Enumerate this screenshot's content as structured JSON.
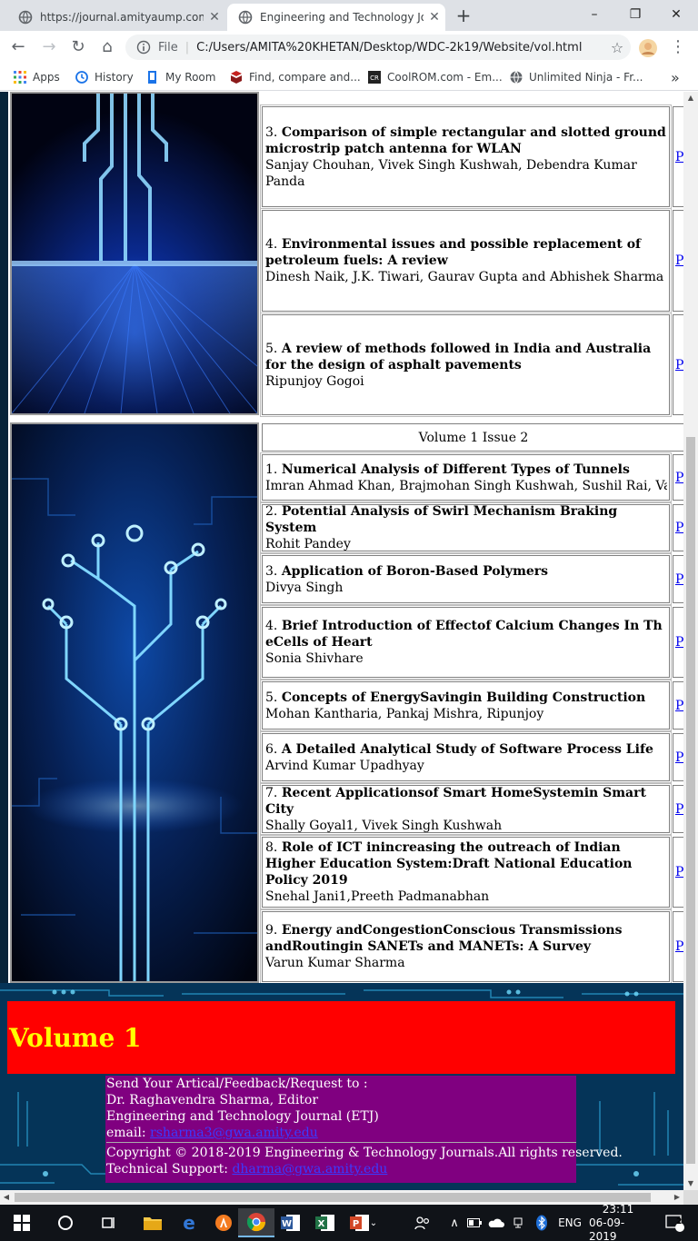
{
  "browser": {
    "tabs": [
      {
        "title": "https://journal.amityaump.com/p",
        "active": false
      },
      {
        "title": "Engineering and Technology Jour",
        "active": true
      }
    ],
    "new_tab": "+",
    "window_controls": {
      "minimize": "–",
      "maximize": "❐",
      "close": "✕"
    },
    "nav": {
      "back": "←",
      "forward": "→",
      "reload": "↻",
      "home": "⌂"
    },
    "address": {
      "scheme_label": "File",
      "separator": "|",
      "url": "C:/Users/AMITA%20KHETAN/Desktop/WDC-2k19/Website/vol.html"
    },
    "menu": "⋮",
    "bookmarks": [
      {
        "label": "Apps",
        "icon": "apps-grid-icon"
      },
      {
        "label": "History",
        "icon": "history-icon"
      },
      {
        "label": "My Room",
        "icon": "room-icon"
      },
      {
        "label": "Find, compare and...",
        "icon": "book-icon"
      },
      {
        "label": "CoolROM.com - Em...",
        "icon": "coolrom-icon"
      },
      {
        "label": "Unlimited Ninja - Fr...",
        "icon": "globe-icon"
      }
    ],
    "bookmarks_more": "»"
  },
  "issue1_tail": [
    {
      "num": "3.",
      "title": "Comparison of simple rectangular and slotted ground microstrip patch antenna for WLAN",
      "authors": "Sanjay Chouhan, Vivek Singh Kushwah, Debendra Kumar Panda",
      "link": "P"
    },
    {
      "num": "4.",
      "title": "Environmental issues and possible replacement of petroleum fuels: A review",
      "authors": "Dinesh Naik, J.K. Tiwari, Gaurav Gupta and Abhishek Sharma",
      "link": "P"
    },
    {
      "num": "5.",
      "title": "A review of methods followed in India and Australia for the design of asphalt pavements",
      "authors": "Ripunjoy Gogoi",
      "link": "P"
    }
  ],
  "issue2": {
    "header": "Volume 1 Issue 2",
    "articles": [
      {
        "num": "1.",
        "title": "Numerical Analysis of Different Types of Tunnels",
        "authors": "Imran Ahmad Khan, Brajmohan Singh Kushwah, Sushil Rai, Vaibhav",
        "link": "P"
      },
      {
        "num": "2.",
        "title": "Potential Analysis of Swirl Mechanism Braking System",
        "authors": "Rohit Pandey",
        "link": "P"
      },
      {
        "num": "3.",
        "title": "Application of Boron-Based Polymers",
        "authors": "Divya Singh",
        "link": "P"
      },
      {
        "num": "4.",
        "title": "Brief Introduction of Effectof Calcium Changes In Th eCells of Heart",
        "authors": "Sonia Shivhare",
        "link": "P"
      },
      {
        "num": "5.",
        "title": "Concepts of EnergySavingin Building Construction",
        "authors": "Mohan Kantharia, Pankaj Mishra, Ripunjoy",
        "link": "P"
      },
      {
        "num": "6.",
        "title": "A Detailed Analytical Study of Software Process Life",
        "authors": "Arvind Kumar Upadhyay",
        "link": "P"
      },
      {
        "num": "7.",
        "title": "Recent Applicationsof Smart HomeSystemin Smart City",
        "authors": "Shally Goyal1, Vivek Singh Kushwah",
        "link": "P"
      },
      {
        "num": "8.",
        "title": "Role of ICT inincreasing the outreach of Indian Higher Education System:Draft National Education Policy 2019",
        "authors": "Snehal Jani1,Preeth Padmanabhan",
        "link": "P"
      },
      {
        "num": "9.",
        "title": "Energy andCongestionConscious Transmissions andRoutingin SANETs and MANETs: A Survey",
        "authors": "Varun Kumar Sharma",
        "link": "P"
      }
    ]
  },
  "footer": {
    "volume_banner": "Volume 1",
    "send_line": "Send Your Artical/Feedback/Request to :",
    "editor": "Dr. Raghavendra Sharma, Editor",
    "journal": "Engineering and Technology Journal (ETJ)",
    "email_label": "email:",
    "email": "rsharma3@gwa.amity.edu",
    "copyright": "Copyright © 2018-2019 Engineering & Technology Journals.All rights reserved.",
    "support_label": "Technical Support:",
    "support_email": "dharma@gwa.amity.edu"
  },
  "taskbar": {
    "apps": [
      "windows-start-icon",
      "search-circle-icon",
      "task-view-icon",
      "file-explorer-icon",
      "edge-icon",
      "avast-icon",
      "chrome-icon",
      "word-icon",
      "excel-icon",
      "powerpoint-icon"
    ],
    "active_app": "chrome-icon",
    "language": "ENG",
    "time": "23:11",
    "date": "06-09-2019",
    "notifications": "2"
  },
  "colors": {
    "volume_banner_bg": "#ff0000",
    "volume_banner_text": "#ffff00",
    "contact_bg": "#800080",
    "link": "#0000ee"
  }
}
